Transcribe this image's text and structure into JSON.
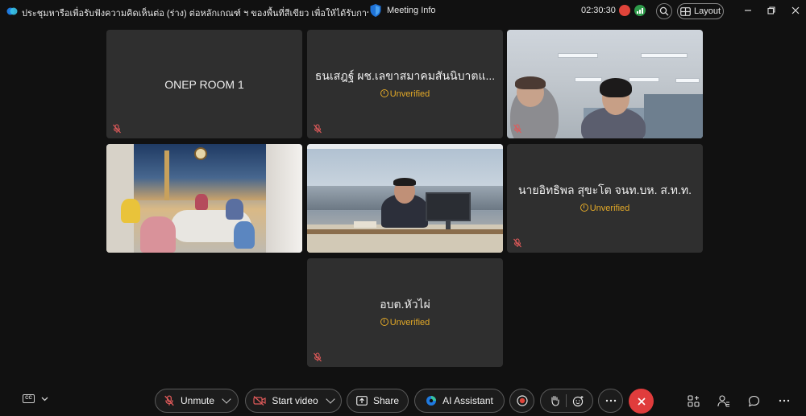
{
  "titlebar": {
    "meeting_title": "ประชุมหารือเพื่อรับฟังความคิดเห็นต่อ (ร่าง) ต่อหลักเกณฑ์ ฯ ของพื้นที่สีเขียว เพื่อให้ได้รับการยกเว้นภาษี",
    "meeting_info_label": "Meeting Info",
    "timer": "02:30:30",
    "layout_label": "Layout"
  },
  "tiles": [
    {
      "name": "ONEP ROOM 1",
      "status": ""
    },
    {
      "name": "ธนเสฎฐ์ ผช.เลขาสมาคมสันนิบาตแ...",
      "status": "Unverified"
    },
    {
      "name": "",
      "status": ""
    },
    {
      "name": "",
      "status": ""
    },
    {
      "name": "",
      "status": ""
    },
    {
      "name": "นายอิทธิพล สุขะโต จนท.บห. ส.ท.ท.",
      "status": "Unverified"
    },
    {
      "name": "อบต.หัวไผ่",
      "status": "Unverified"
    }
  ],
  "toolbar": {
    "unmute_label": "Unmute",
    "start_video_label": "Start video",
    "share_label": "Share",
    "ai_assistant_label": "AI Assistant"
  },
  "colors": {
    "background": "#111111",
    "tile": "#2f2f2f",
    "unverified": "#e3a928",
    "end_call": "#e03c3c",
    "mute_icon": "#e05a5a"
  },
  "icons": {
    "app": "webex-logo-icon",
    "security": "shield-icon",
    "muted": "microphone-muted-icon",
    "video_off": "video-off-icon",
    "end": "close-icon"
  }
}
